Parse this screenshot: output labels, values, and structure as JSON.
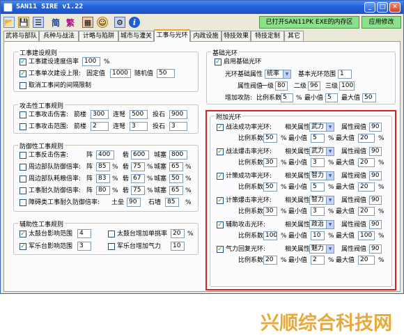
{
  "window": {
    "title": "SAN11 SIRE v1.22"
  },
  "titlebar_buttons": {
    "minimize": "_",
    "maximize": "□",
    "close": "✕"
  },
  "toolbar": {
    "icons": [
      {
        "name": "folder-icon",
        "glyph": "📂"
      },
      {
        "name": "save-icon",
        "glyph": "💾"
      },
      {
        "name": "list-icon",
        "glyph": "☰"
      },
      {
        "name": "simplified",
        "glyph": "简"
      },
      {
        "name": "traditional",
        "glyph": "繁"
      },
      {
        "name": "chart-icon",
        "glyph": "▦"
      },
      {
        "name": "face-icon",
        "glyph": "☺"
      },
      {
        "name": "settings-icon",
        "glyph": "⚙"
      },
      {
        "name": "info-icon",
        "glyph": "i"
      }
    ],
    "status": "已打开SAN11PK EXE的内存区",
    "apply": "应用修改"
  },
  "tabs": [
    "武将与部队",
    "兵种与战法",
    "计略与陷阱",
    "城市与灌关",
    "工事与光环",
    "内政设施",
    "特技效果",
    "特技定制",
    "其它"
  ],
  "active_tab": 4,
  "construction": {
    "title": "工事建设规则",
    "speed_label": "工事建设速度倍率",
    "speed_value": "100",
    "speed_unit": "%",
    "limit_label": "工事单次建设上限:",
    "fixed_label": "固定值",
    "fixed_value": "1000",
    "random_label": "随机值",
    "random_value": "50",
    "cancel_label": "取消工事间的间隔限制"
  },
  "attack": {
    "title": "攻击性工事规则",
    "damage_label": "工事攻击伤害:",
    "range_label": "工事攻击范围:",
    "arrow": "箭楼",
    "cont": "连弩",
    "stone": "投石",
    "damage_values": [
      "300",
      "500",
      "900"
    ],
    "range_values": [
      "2",
      "3",
      "3"
    ]
  },
  "defense": {
    "title": "防御性工事规则",
    "rows": [
      {
        "label": "工事反击伤害:",
        "a": "阵",
        "av": "400",
        "b": "砦",
        "bv": "600",
        "c": "城塞",
        "cv": "800",
        "unit": ""
      },
      {
        "label": "周边部队防御倍率:",
        "a": "阵",
        "av": "85",
        "b": "砦",
        "bv": "75",
        "c": "城塞",
        "cv": "65",
        "unit": "%"
      },
      {
        "label": "周边部队耗粮倍率:",
        "a": "阵",
        "av": "83",
        "b": "砦",
        "bv": "67",
        "c": "城塞",
        "cv": "50",
        "unit": "%"
      },
      {
        "label": "工事耐久防御倍率:",
        "a": "阵",
        "av": "80",
        "b": "砦",
        "bv": "75",
        "c": "城塞",
        "cv": "65",
        "unit": "%"
      }
    ],
    "block_label": "障碍类工事耐久防御倍率:",
    "earth": "土垒",
    "earth_value": "90",
    "stonewall": "石墙",
    "stonewall_value": "85",
    "block_unit": "%"
  },
  "auxiliary": {
    "title": "辅助性工事规则",
    "drum_range_label": "太鼓台影响范围",
    "drum_range_value": "4",
    "drum_morale_label": "太鼓台增加单挑率",
    "drum_morale_value": "20",
    "drum_morale_unit": "%",
    "band_range_label": "军乐台影响范围",
    "band_range_value": "3",
    "band_power_label": "军乐台增加气力",
    "band_power_value": "10"
  },
  "basic_aura": {
    "title": "基础光环",
    "enable_label": "启用基础光环",
    "attr_label": "光环基础属性",
    "attr_value": "统率",
    "range_label": "基本光环范围",
    "range_value": "1",
    "threshold_label": "属性阀值",
    "lv1": "一级",
    "lv1_value": "80",
    "lv2": "二级",
    "lv2_value": "96",
    "lv3": "三级",
    "lv3_value": "100",
    "dmg_label": "增加攻防:",
    "ratio_label": "比例系数",
    "ratio_value": "5",
    "min_label": "最小值",
    "min_value": "5",
    "max_label": "最大值",
    "max_value": "50",
    "unit": "%"
  },
  "extra_aura": {
    "title": "附加光环",
    "attr_related": "相关属性",
    "attr_threshold": "属性阀值",
    "ratio_label": "比例系数",
    "min_label": "最小值",
    "max_label": "最大值",
    "unit": "%",
    "rows": [
      {
        "label": "战法成功率光环:",
        "attr": "武力",
        "threshold": "90",
        "ratio": "50",
        "min": "5",
        "max": "20"
      },
      {
        "label": "战法爆击率光环:",
        "attr": "武力",
        "threshold": "90",
        "ratio": "30",
        "min": "3",
        "max": "20"
      },
      {
        "label": "计策成功率光环:",
        "attr": "智力",
        "threshold": "90",
        "ratio": "50",
        "min": "5",
        "max": "20"
      },
      {
        "label": "计策爆击率光环:",
        "attr": "智力",
        "threshold": "90",
        "ratio": "30",
        "min": "3",
        "max": "20"
      },
      {
        "label": "辅助攻击光环:",
        "attr": "政治",
        "threshold": "90",
        "ratio": "100",
        "min": "10",
        "max": "100"
      },
      {
        "label": "气力回复光环:",
        "attr": "魅力",
        "threshold": "90",
        "ratio": "20",
        "min": "2",
        "max": "20"
      }
    ]
  },
  "watermark": "兴顺综合科技网"
}
